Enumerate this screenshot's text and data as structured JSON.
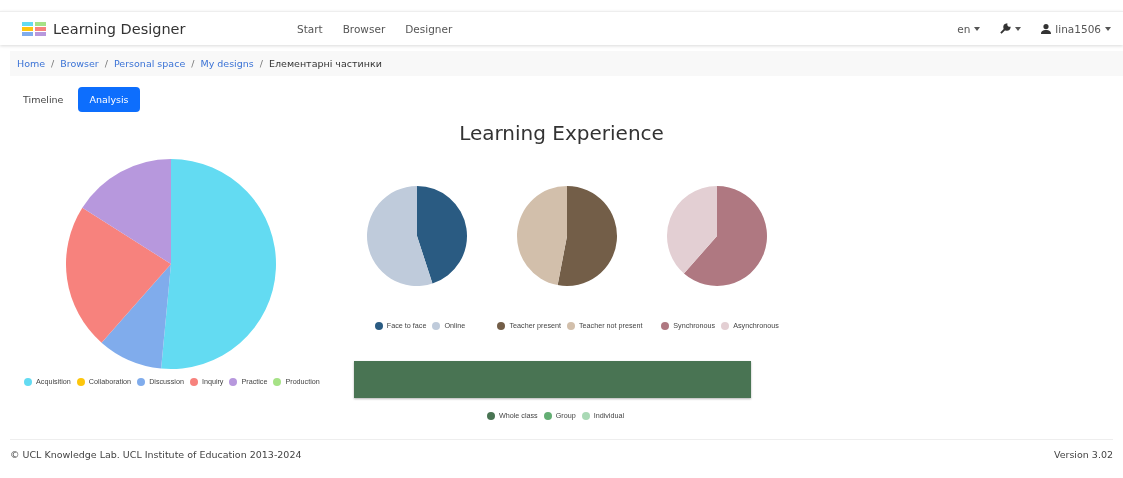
{
  "navbar": {
    "brand": "Learning Designer",
    "links": [
      "Start",
      "Browser",
      "Designer"
    ],
    "language": "en",
    "user": "lina1506"
  },
  "breadcrumb_separator": "/",
  "breadcrumb": [
    {
      "label": "Home",
      "link": true
    },
    {
      "label": "Browser",
      "link": true
    },
    {
      "label": "Personal space",
      "link": true
    },
    {
      "label": "My designs",
      "link": true
    },
    {
      "label": "Елементарні частинки",
      "link": false
    }
  ],
  "tabs": [
    {
      "label": "Timeline",
      "selected": false
    },
    {
      "label": "Analysis",
      "selected": true
    }
  ],
  "title": "Learning Experience",
  "charts": [
    {
      "kind": "pie",
      "legend": [
        {
          "label": "Acquisition",
          "color": "#63dbf2"
        },
        {
          "label": "Collaboration",
          "color": "#fdc60c"
        },
        {
          "label": "Discussion",
          "color": "#80acec"
        },
        {
          "label": "Inquiry",
          "color": "#f7827d"
        },
        {
          "label": "Practice",
          "color": "#b798dd"
        },
        {
          "label": "Production",
          "color": "#a6e286"
        }
      ]
    },
    {
      "kind": "pie",
      "legend": [
        {
          "label": "Face to face",
          "color": "#2a5b82"
        },
        {
          "label": "Online",
          "color": "#bfcbdb"
        }
      ]
    },
    {
      "kind": "pie",
      "legend": [
        {
          "label": "Teacher present",
          "color": "#735e48"
        },
        {
          "label": "Teacher not present",
          "color": "#d2bfab"
        }
      ]
    },
    {
      "kind": "pie",
      "legend": [
        {
          "label": "Synchronous",
          "color": "#af7881"
        },
        {
          "label": "Asynchronous",
          "color": "#e3cfd3"
        }
      ]
    },
    {
      "kind": "bar",
      "legend": [
        {
          "label": "Whole class",
          "color": "#497453"
        },
        {
          "label": "Group",
          "color": "#63ae73"
        },
        {
          "label": "Individual",
          "color": "#a9d9b5"
        }
      ]
    }
  ],
  "footer": {
    "copyright": "© UCL Knowledge Lab. UCL Institute of Education 2013-2024",
    "version": "Version 3.02"
  }
}
